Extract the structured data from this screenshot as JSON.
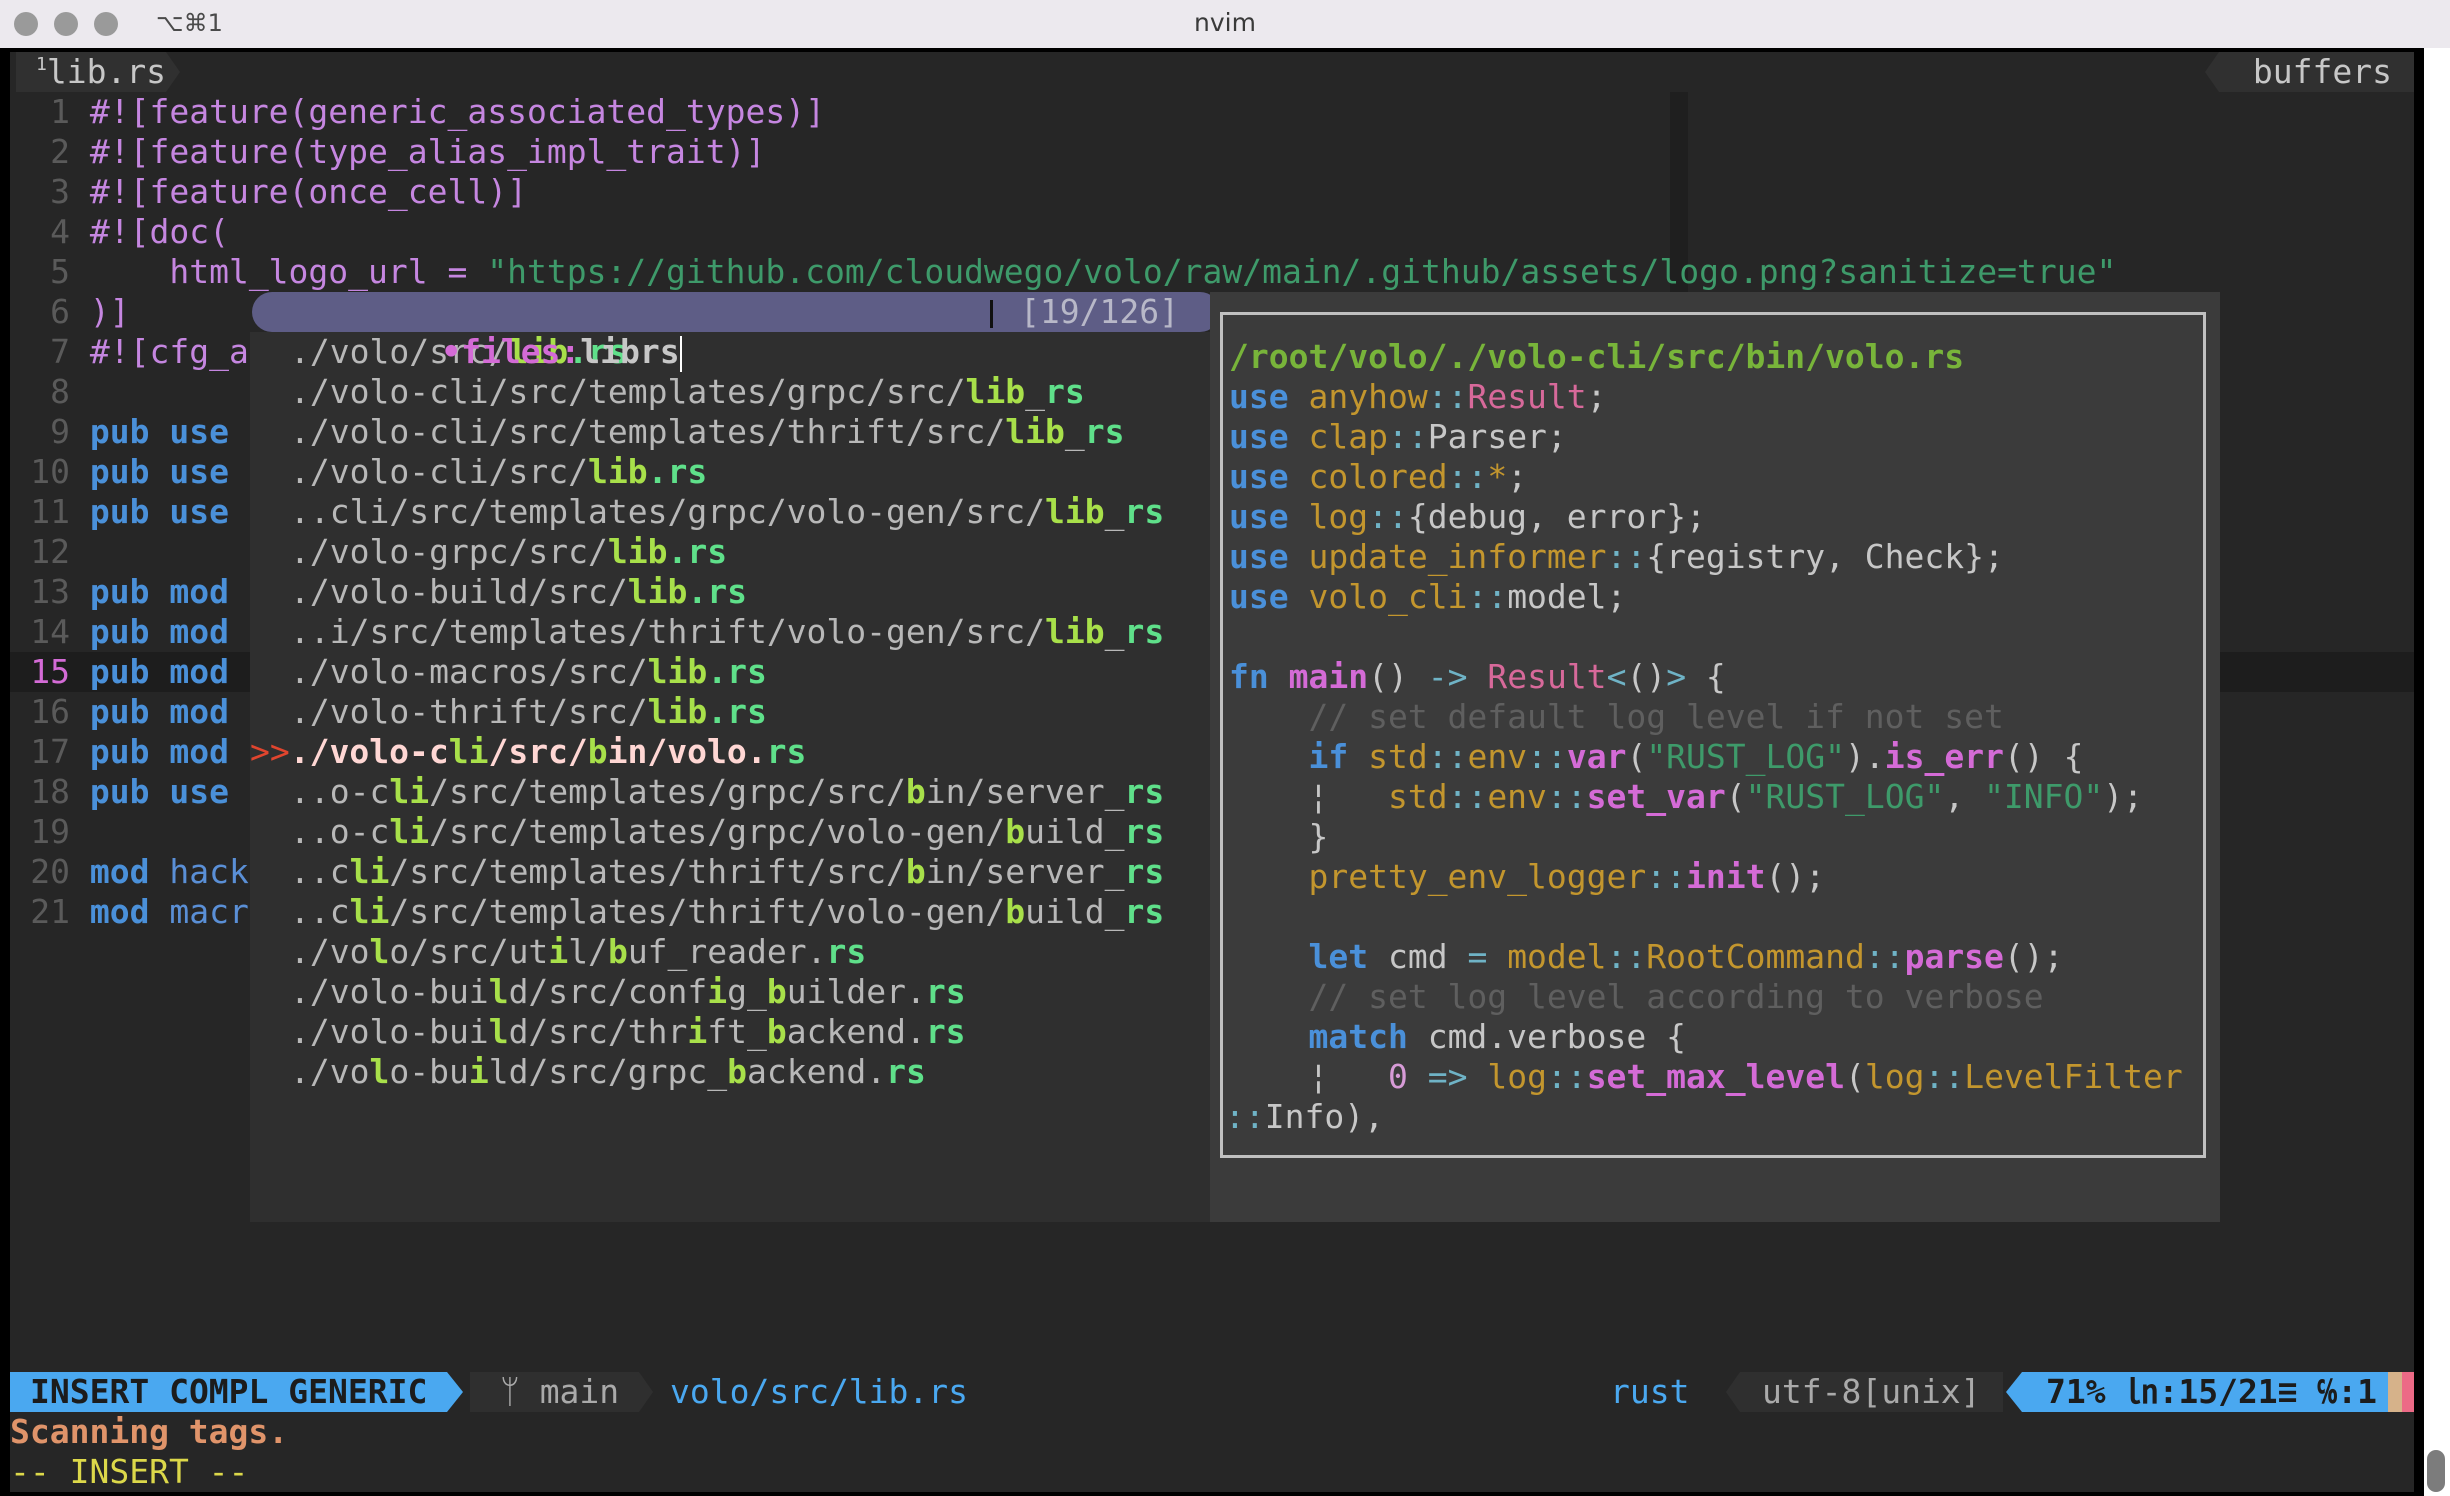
{
  "window": {
    "title": "nvim",
    "shortcut": "⌥⌘1"
  },
  "tabline": {
    "tab_number": "1",
    "tab_label": "lib.rs",
    "right_label": "buffers"
  },
  "editor": {
    "current_line": 15,
    "lines": [
      {
        "n": "1",
        "segs": [
          [
            "attr",
            "#![feature(generic_associated_types)]"
          ]
        ]
      },
      {
        "n": "2",
        "segs": [
          [
            "attr",
            "#![feature(type_alias_impl_trait)]"
          ]
        ]
      },
      {
        "n": "3",
        "segs": [
          [
            "attr",
            "#![feature(once_cell)]"
          ]
        ]
      },
      {
        "n": "4",
        "segs": [
          [
            "attr",
            "#![doc("
          ]
        ]
      },
      {
        "n": "5",
        "segs": [
          [
            "attr",
            "    html_logo_url = "
          ],
          [
            "str",
            "\"https://github.com/cloudwego/volo/raw/main/.github/assets/logo.png?sanitize=true\""
          ]
        ]
      },
      {
        "n": "6",
        "segs": [
          [
            "attr",
            ")]"
          ]
        ]
      },
      {
        "n": "7",
        "segs": [
          [
            "attr",
            "#![cfg_a"
          ]
        ]
      },
      {
        "n": "8",
        "segs": []
      },
      {
        "n": "9",
        "segs": [
          [
            "kw",
            "pub use"
          ]
        ]
      },
      {
        "n": "10",
        "segs": [
          [
            "kw",
            "pub use"
          ]
        ]
      },
      {
        "n": "11",
        "segs": [
          [
            "kw",
            "pub use"
          ]
        ]
      },
      {
        "n": "12",
        "segs": []
      },
      {
        "n": "13",
        "segs": [
          [
            "kw",
            "pub mod"
          ]
        ]
      },
      {
        "n": "14",
        "segs": [
          [
            "kw",
            "pub mod"
          ]
        ]
      },
      {
        "n": "15",
        "segs": [
          [
            "kw",
            "pub mod"
          ]
        ]
      },
      {
        "n": "16",
        "segs": [
          [
            "kw",
            "pub mod"
          ]
        ]
      },
      {
        "n": "17",
        "segs": [
          [
            "kw",
            "pub mod"
          ]
        ]
      },
      {
        "n": "18",
        "segs": [
          [
            "kw",
            "pub use"
          ]
        ]
      },
      {
        "n": "19",
        "segs": []
      },
      {
        "n": "20",
        "segs": [
          [
            "kw",
            "mod"
          ],
          [
            "kwn",
            " hack"
          ]
        ]
      },
      {
        "n": "21",
        "segs": [
          [
            "kw",
            "mod"
          ],
          [
            "kwn",
            " macr"
          ]
        ]
      }
    ]
  },
  "picker": {
    "prompt_prefix": "•files:",
    "query": "librs",
    "count": "[19/126]",
    "selected_marker": ">>",
    "selected_index": 11,
    "items": [
      [
        [
          "p",
          "./volo/src/"
        ],
        [
          "h",
          "lib"
        ],
        [
          "e",
          ".rs"
        ]
      ],
      [
        [
          "p",
          "./volo-cli/src/templates/grpc/src/"
        ],
        [
          "h",
          "lib"
        ],
        [
          "p",
          "_"
        ],
        [
          "e",
          "rs"
        ]
      ],
      [
        [
          "p",
          "./volo-cli/src/templates/thrift/src/"
        ],
        [
          "h",
          "lib"
        ],
        [
          "p",
          "_"
        ],
        [
          "e",
          "rs"
        ]
      ],
      [
        [
          "p",
          "./volo-cli/src/"
        ],
        [
          "h",
          "lib"
        ],
        [
          "e",
          ".rs"
        ]
      ],
      [
        [
          "p",
          "..cli/src/templates/grpc/volo-gen/src/"
        ],
        [
          "h",
          "lib"
        ],
        [
          "p",
          "_"
        ],
        [
          "e",
          "rs"
        ]
      ],
      [
        [
          "p",
          "./volo-grpc/src/"
        ],
        [
          "h",
          "lib"
        ],
        [
          "e",
          ".rs"
        ]
      ],
      [
        [
          "p",
          "./volo-build/src/"
        ],
        [
          "h",
          "lib"
        ],
        [
          "e",
          ".rs"
        ]
      ],
      [
        [
          "p",
          "..i/src/templates/thrift/volo-gen/src/"
        ],
        [
          "h",
          "lib"
        ],
        [
          "p",
          "_"
        ],
        [
          "e",
          "rs"
        ]
      ],
      [
        [
          "p",
          "./volo-macros/src/"
        ],
        [
          "h",
          "lib"
        ],
        [
          "e",
          ".rs"
        ]
      ],
      [
        [
          "p",
          "./volo-thrift/src/"
        ],
        [
          "h",
          "lib"
        ],
        [
          "e",
          ".rs"
        ]
      ],
      [
        [
          "s",
          "./volo-c"
        ],
        [
          "h",
          "li"
        ],
        [
          "s",
          "/src/"
        ],
        [
          "h",
          "b"
        ],
        [
          "s",
          "in/volo."
        ],
        [
          "e",
          "rs"
        ]
      ],
      [
        [
          "p",
          "..o-c"
        ],
        [
          "h",
          "li"
        ],
        [
          "p",
          "/src/templates/grpc/src/"
        ],
        [
          "h",
          "b"
        ],
        [
          "p",
          "in/server_"
        ],
        [
          "e",
          "rs"
        ]
      ],
      [
        [
          "p",
          "..o-c"
        ],
        [
          "h",
          "li"
        ],
        [
          "p",
          "/src/templates/grpc/volo-gen/"
        ],
        [
          "h",
          "b"
        ],
        [
          "p",
          "uild_"
        ],
        [
          "e",
          "rs"
        ]
      ],
      [
        [
          "p",
          "..c"
        ],
        [
          "h",
          "li"
        ],
        [
          "p",
          "/src/templates/thrift/src/"
        ],
        [
          "h",
          "b"
        ],
        [
          "p",
          "in/server_"
        ],
        [
          "e",
          "rs"
        ]
      ],
      [
        [
          "p",
          "..c"
        ],
        [
          "h",
          "li"
        ],
        [
          "p",
          "/src/templates/thrift/volo-gen/"
        ],
        [
          "h",
          "b"
        ],
        [
          "p",
          "uild_"
        ],
        [
          "e",
          "rs"
        ]
      ],
      [
        [
          "p",
          "./vo"
        ],
        [
          "h",
          "l"
        ],
        [
          "p",
          "o/src/ut"
        ],
        [
          "h",
          "i"
        ],
        [
          "p",
          "l/"
        ],
        [
          "h",
          "b"
        ],
        [
          "p",
          "uf_reader."
        ],
        [
          "e",
          "rs"
        ]
      ],
      [
        [
          "p",
          "./volo-bui"
        ],
        [
          "h",
          "l"
        ],
        [
          "p",
          "d/src/conf"
        ],
        [
          "h",
          "i"
        ],
        [
          "p",
          "g_"
        ],
        [
          "h",
          "b"
        ],
        [
          "p",
          "uilder."
        ],
        [
          "e",
          "rs"
        ]
      ],
      [
        [
          "p",
          "./volo-bui"
        ],
        [
          "h",
          "l"
        ],
        [
          "p",
          "d/src/thr"
        ],
        [
          "h",
          "i"
        ],
        [
          "p",
          "ft_"
        ],
        [
          "h",
          "b"
        ],
        [
          "p",
          "ackend."
        ],
        [
          "e",
          "rs"
        ]
      ],
      [
        [
          "p",
          "./vo"
        ],
        [
          "h",
          "l"
        ],
        [
          "p",
          "o-bu"
        ],
        [
          "h",
          "i"
        ],
        [
          "p",
          "ld/src/grpc_"
        ],
        [
          "h",
          "b"
        ],
        [
          "p",
          "ackend."
        ],
        [
          "e",
          "rs"
        ]
      ]
    ]
  },
  "preview": {
    "lines": [
      [
        [
          "path",
          "/root/volo/./volo-cli/src/bin/volo.rs"
        ]
      ],
      [
        [
          "kw",
          "use"
        ],
        [
          "t",
          " "
        ],
        [
          "mod",
          "anyhow"
        ],
        [
          "pu",
          "::"
        ],
        [
          "ty",
          "Result"
        ],
        [
          "t",
          ";"
        ]
      ],
      [
        [
          "kw",
          "use"
        ],
        [
          "t",
          " "
        ],
        [
          "mod",
          "clap"
        ],
        [
          "pu",
          "::"
        ],
        [
          "t",
          "Parser;"
        ]
      ],
      [
        [
          "kw",
          "use"
        ],
        [
          "t",
          " "
        ],
        [
          "mod",
          "colored"
        ],
        [
          "pu",
          "::"
        ],
        [
          "mod",
          "*"
        ],
        [
          "t",
          ";"
        ]
      ],
      [
        [
          "kw",
          "use"
        ],
        [
          "t",
          " "
        ],
        [
          "mod",
          "log"
        ],
        [
          "pu",
          "::"
        ],
        [
          "t",
          "{debug, error};"
        ]
      ],
      [
        [
          "kw",
          "use"
        ],
        [
          "t",
          " "
        ],
        [
          "mod",
          "update_informer"
        ],
        [
          "pu",
          "::"
        ],
        [
          "t",
          "{registry, Check};"
        ]
      ],
      [
        [
          "kw",
          "use"
        ],
        [
          "t",
          " "
        ],
        [
          "mod",
          "volo_cli"
        ],
        [
          "pu",
          "::"
        ],
        [
          "t",
          "model;"
        ]
      ],
      [],
      [
        [
          "kw",
          "fn"
        ],
        [
          "t",
          " "
        ],
        [
          "fn",
          "main"
        ],
        [
          "t",
          "() "
        ],
        [
          "pu",
          "->"
        ],
        [
          "t",
          " "
        ],
        [
          "ty",
          "Result"
        ],
        [
          "pu",
          "<"
        ],
        [
          "t",
          "()"
        ],
        [
          "pu",
          ">"
        ],
        [
          "t",
          " {"
        ]
      ],
      [
        [
          "t",
          "    "
        ],
        [
          "cmt",
          "// set default log level if not set"
        ]
      ],
      [
        [
          "t",
          "    "
        ],
        [
          "kw",
          "if"
        ],
        [
          "t",
          " "
        ],
        [
          "mod",
          "std"
        ],
        [
          "pu",
          "::"
        ],
        [
          "mod",
          "env"
        ],
        [
          "pu",
          "::"
        ],
        [
          "fn",
          "var"
        ],
        [
          "t",
          "("
        ],
        [
          "str",
          "\"RUST_LOG\""
        ],
        [
          "t",
          ")."
        ],
        [
          "fn",
          "is_err"
        ],
        [
          "t",
          "() {"
        ]
      ],
      [
        [
          "t",
          "    ¦   "
        ],
        [
          "mod",
          "std"
        ],
        [
          "pu",
          "::"
        ],
        [
          "mod",
          "env"
        ],
        [
          "pu",
          "::"
        ],
        [
          "fn",
          "set_var"
        ],
        [
          "t",
          "("
        ],
        [
          "str",
          "\"RUST_LOG\""
        ],
        [
          "t",
          ", "
        ],
        [
          "str",
          "\"INFO\""
        ],
        [
          "t",
          ");"
        ]
      ],
      [
        [
          "t",
          "    }"
        ]
      ],
      [
        [
          "t",
          "    "
        ],
        [
          "mod",
          "pretty_env_logger"
        ],
        [
          "pu",
          "::"
        ],
        [
          "fn",
          "init"
        ],
        [
          "t",
          "();"
        ]
      ],
      [],
      [
        [
          "t",
          "    "
        ],
        [
          "kw",
          "let"
        ],
        [
          "t",
          " cmd "
        ],
        [
          "pu",
          "="
        ],
        [
          "t",
          " "
        ],
        [
          "mod",
          "model"
        ],
        [
          "pu",
          "::"
        ],
        [
          "mod",
          "RootCommand"
        ],
        [
          "pu",
          "::"
        ],
        [
          "fn",
          "parse"
        ],
        [
          "t",
          "();"
        ]
      ],
      [
        [
          "t",
          "    "
        ],
        [
          "cmt",
          "// set log level according to verbose"
        ]
      ],
      [
        [
          "t",
          "    "
        ],
        [
          "kw",
          "match"
        ],
        [
          "t",
          " cmd.verbose {"
        ]
      ],
      [
        [
          "t",
          "    ¦   "
        ],
        [
          "num",
          "0"
        ],
        [
          "t",
          " "
        ],
        [
          "pu",
          "=>"
        ],
        [
          "t",
          " "
        ],
        [
          "mod",
          "log"
        ],
        [
          "pu",
          "::"
        ],
        [
          "fn",
          "set_max_level"
        ],
        [
          "t",
          "("
        ],
        [
          "mod",
          "log"
        ],
        [
          "pu",
          "::"
        ],
        [
          "mod",
          "LevelFilter"
        ]
      ],
      [
        [
          "pu",
          "::"
        ],
        [
          "t",
          "Info),"
        ]
      ]
    ]
  },
  "statusline": {
    "mode": "INSERT COMPL GENERIC",
    "branch_icon": "git-branch-icon",
    "branch": "main",
    "file_path": "volo/src/lib.rs",
    "filetype": "rust",
    "encoding": "utf-8[unix]",
    "position": "71% ㏑:15/21≡ ℅:1"
  },
  "messages": {
    "line1": "Scanning tags.",
    "line2": "-- INSERT --"
  },
  "colors": {
    "mode_bg": "#4aa8f0",
    "background": "#262626",
    "popup_prompt_bg": "#5e5d86"
  }
}
